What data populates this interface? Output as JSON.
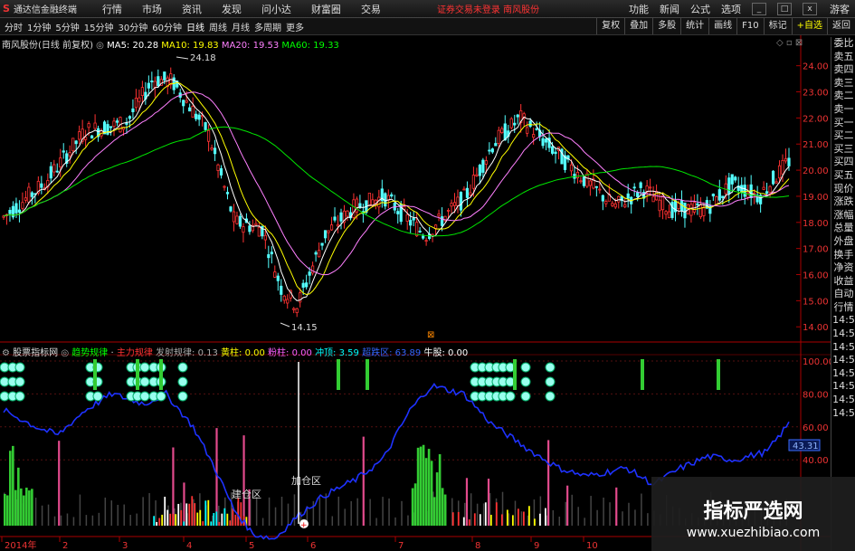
{
  "app": {
    "logo_text": "S",
    "name": "通达信金融终端"
  },
  "menu": [
    "行情",
    "市场",
    "资讯",
    "发现",
    "问小达",
    "财富圈",
    "交易"
  ],
  "status_text": "证券交易未登录  南风股份",
  "menu_right": [
    "功能",
    "新闻",
    "公式",
    "选项",
    "游客"
  ],
  "window_buttons": [
    "_",
    "□",
    "x"
  ],
  "periods": [
    "分时",
    "1分钟",
    "5分钟",
    "15分钟",
    "30分钟",
    "60分钟",
    "日线",
    "周线",
    "月线",
    "多周期",
    "更多"
  ],
  "toolbar_right": [
    "复权",
    "叠加",
    "多股",
    "统计",
    "画线",
    "F10",
    "标记",
    "+自选",
    "返回"
  ],
  "price_legend": {
    "title": "南风股份(日线 前复权)",
    "ma5": "MA5: 20.28",
    "ma10": "MA10: 19.83",
    "ma20": "MA20: 19.53",
    "ma60": "MA60: 19.33"
  },
  "price_axis": [
    "24.00",
    "23.00",
    "22.00",
    "21.00",
    "20.00",
    "19.00",
    "18.00",
    "17.00",
    "16.00",
    "15.00",
    "14.00"
  ],
  "price_annotations": {
    "high": "24.18",
    "low": "14.15"
  },
  "indicator_legend": {
    "name": "股票指标网",
    "trend": "趋势规律",
    "main": "主力规律",
    "launch": "发射规律: 0.13",
    "yellow": "黄柱: 0.00",
    "pink": "粉柱: 0.00",
    "rise": "冲顶: 3.59",
    "cyan": "超跌区: 63.89",
    "bull": "牛股: 0.00"
  },
  "indicator_axis": [
    "100.00",
    "80.00",
    "60.00",
    "40.00"
  ],
  "indicator_value": "43.31",
  "zone_labels": {
    "build": "建仓区",
    "add": "加仓区"
  },
  "time_axis": [
    "2014年",
    "2",
    "3",
    "4",
    "5",
    "6",
    "7",
    "8",
    "9",
    "10"
  ],
  "side_panel": [
    "委比",
    "卖五",
    "卖四",
    "卖三",
    "卖二",
    "卖一",
    "买一",
    "买二",
    "买三",
    "买四",
    "买五",
    "现价",
    "涨跌",
    "涨幅",
    "总量",
    "外盘",
    "换手",
    "净资",
    "收益",
    "自动",
    "行情",
    "14:5",
    "14:5",
    "14:5",
    "14:5",
    "14:5",
    "14:5",
    "14:5",
    "14:5"
  ],
  "watermark": {
    "title": "指标严选网",
    "url": "www.xuezhibiao.com"
  },
  "colors": {
    "up": "#ff3232",
    "down": "#54ffff",
    "ma5": "#ffffff",
    "ma10": "#ffff00",
    "ma20": "#ff80ff",
    "ma60": "#00e600",
    "curve": "#1e32ff"
  }
}
